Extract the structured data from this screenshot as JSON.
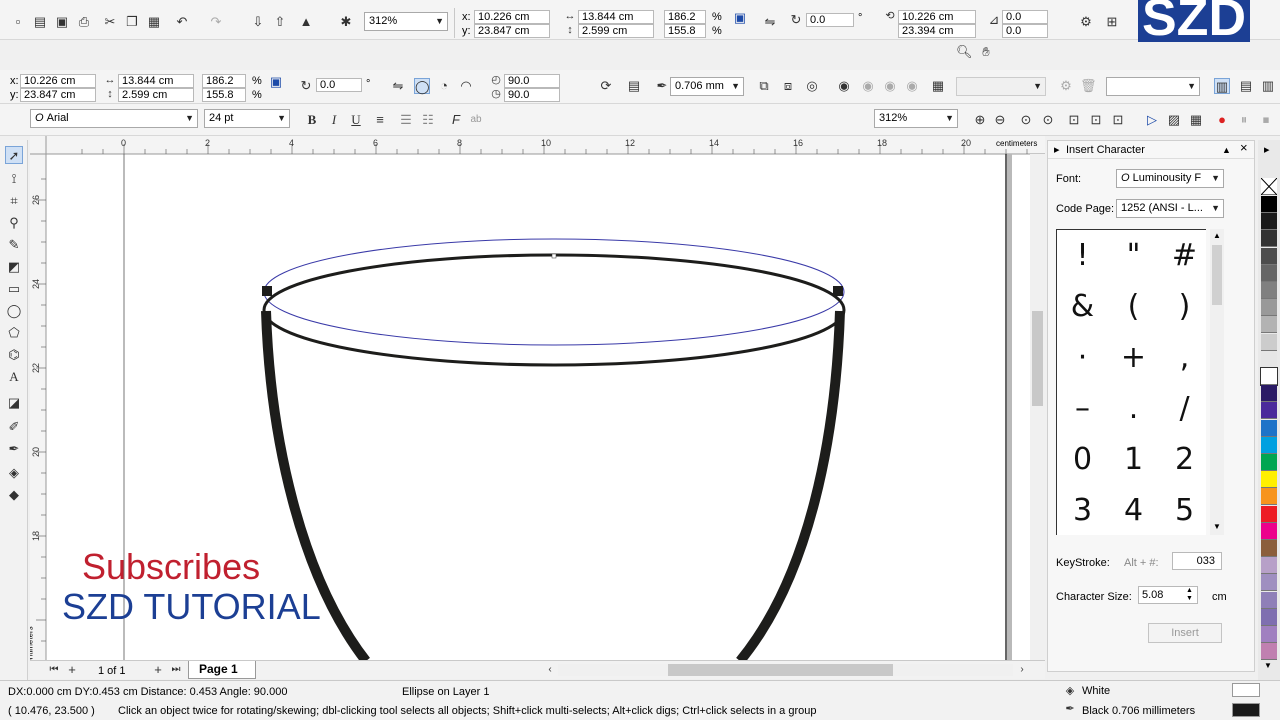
{
  "logo": {
    "text": "SZD"
  },
  "prop_bar1": {
    "x_label": "x:",
    "x": "10.226 cm",
    "y_label": "y:",
    "y": "23.847 cm",
    "w": "13.844 cm",
    "h": "2.599 cm",
    "scale_w": "186.2",
    "scale_h": "155.8",
    "pct": "%",
    "zoom": "312%",
    "angle": "0.0",
    "cx": "10.226 cm",
    "cy": "23.394 cm",
    "skew_h": "0.0",
    "skew_v": "0.0"
  },
  "prop_bar2": {
    "x_label": "x:",
    "x": "10.226 cm",
    "y_label": "y:",
    "y": "23.847 cm",
    "w": "13.844 cm",
    "h": "2.599 cm",
    "scale_w": "186.2",
    "scale_h": "155.8",
    "pct": "%",
    "angle": "0.0",
    "start_angle": "90.0",
    "end_angle": "90.0",
    "outline_width": "0.706 mm"
  },
  "text_bar": {
    "font": "Arial",
    "size": "24 pt",
    "zoom": "312%"
  },
  "ruler": {
    "unit": "centimeters",
    "h_ticks": [
      "0",
      "2",
      "4",
      "6",
      "8",
      "10",
      "12",
      "14",
      "16",
      "18",
      "20"
    ],
    "v_ticks": [
      "26",
      "24",
      "22",
      "20",
      "18"
    ]
  },
  "page_nav": {
    "count": "1 of 1",
    "tab": "Page 1"
  },
  "watermark": {
    "line1": "Subscribes",
    "line2": "SZD TUTORIAL"
  },
  "docker": {
    "title": "Insert Character",
    "font_label": "Font:",
    "font_value": "Luminousity F",
    "codepage_label": "Code Page:",
    "codepage_value": "1252 (ANSI - L...",
    "chars": [
      "!",
      "\"",
      "#",
      "&",
      "(",
      ")",
      "·",
      "+",
      ",",
      "–",
      ".",
      "/",
      "0",
      "1",
      "2",
      "3",
      "4",
      "5"
    ],
    "keystroke_label": "KeyStroke:",
    "keystroke_hint": "Alt + #:",
    "keystroke_value": "033",
    "charsize_label": "Character Size:",
    "charsize_value": "5.08",
    "charsize_unit": "cm",
    "insert_button": "Insert"
  },
  "palette": {
    "colors": [
      "#000000",
      "#1a1a1a",
      "#333333",
      "#4d4d4d",
      "#666666",
      "#808080",
      "#999999",
      "#b3b3b3",
      "#cccccc",
      "#e6e6e6",
      "#ffffff",
      "#2b1b66",
      "#4b2a9b",
      "#1e73c8",
      "#00a0e0",
      "#00a651",
      "#ffef00",
      "#f7941d",
      "#ed1c24",
      "#ec008c",
      "#8b5e3c",
      "#b7a0c8",
      "#9f8fc0",
      "#8f7fb8",
      "#7f6fb0",
      "#a080c0",
      "#c080b0"
    ]
  },
  "status": {
    "line1": "DX:0.000 cm DY:0.453 cm Distance: 0.453 Angle: 90.000",
    "object_info": "Ellipse on Layer 1",
    "coords": "( 10.476, 23.500 )",
    "hint": "Click an object twice for rotating/skewing; dbl-clicking tool selects all objects; Shift+click multi-selects; Alt+click digs; Ctrl+click selects in a group",
    "fill_label": "White",
    "outline_label": "Black  0.706 millimeters",
    "fill_color": "#ffffff",
    "outline_color": "#1a1a1a"
  },
  "accent": "#1c4aa8"
}
